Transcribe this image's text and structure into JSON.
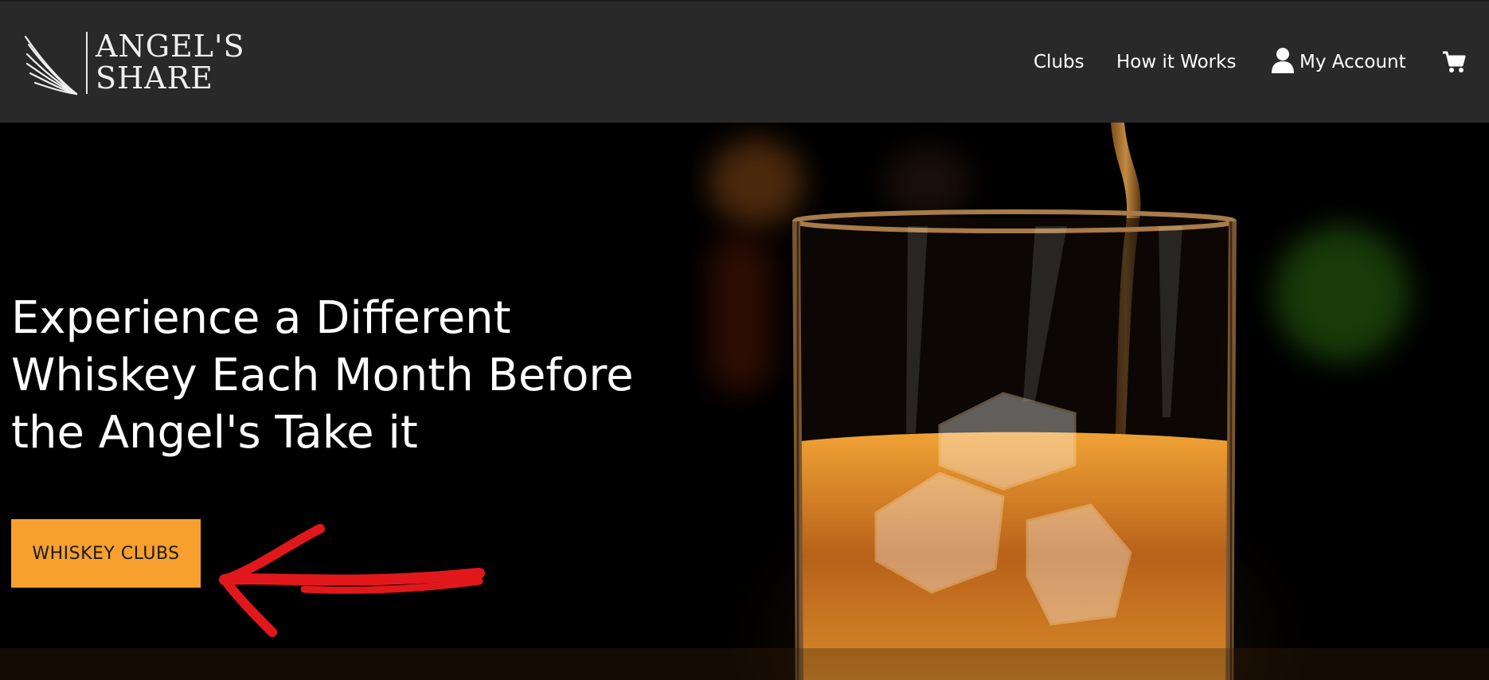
{
  "brand": {
    "logo_line1": "ANGEL'S",
    "logo_line2": "SHARE"
  },
  "nav": {
    "clubs": "Clubs",
    "how_it_works": "How it Works",
    "my_account": "My Account",
    "user_icon": "user-icon",
    "cart_icon": "shopping-cart-icon"
  },
  "hero": {
    "headline_line1": "Experience a Different",
    "headline_line2": "Whiskey Each Month Before",
    "headline_line3": "the Angel's Take it",
    "cta_label": "WHISKEY CLUBS",
    "annotation_arrow": "red-hand-drawn-arrow"
  },
  "colors": {
    "header_bg": "#292929",
    "cta_bg": "#f7a02e",
    "arrow": "#e0181b",
    "text": "#ffffff"
  }
}
